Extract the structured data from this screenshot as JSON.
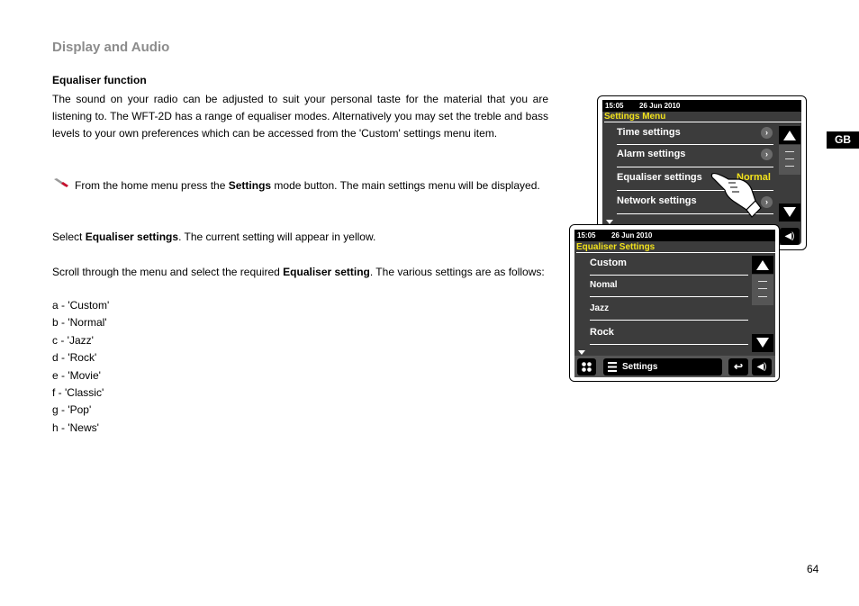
{
  "page": {
    "section_title": "Display and Audio",
    "subheading": "Equaliser function",
    "intro": "The sound on your radio can be adjusted to suit your personal taste for the material that you are listening to. The WFT-2D has a range of equaliser modes. Alternatively you may set the treble and bass levels to your own preferences which can be accessed from the 'Custom' settings menu item.",
    "step1": {
      "pre": "From the home menu press the ",
      "bold": "Settings",
      "post": " mode button. The main settings menu will be displayed."
    },
    "step2": {
      "pre": "Select ",
      "bold": "Equaliser settings",
      "post": ". The current setting will appear in yellow."
    },
    "step3": {
      "pre": "Scroll through the menu and select the required ",
      "bold": "Equaliser setting",
      "post": ". The various settings are as follows:"
    },
    "options": [
      "a - 'Custom'",
      "b - 'Normal'",
      "c - 'Jazz'",
      "d - 'Rock'",
      "e - 'Movie'",
      "f - 'Classic'",
      "g - 'Pop'",
      "h - 'News'"
    ],
    "language_tab": "GB",
    "page_number": "64"
  },
  "screen1": {
    "time": "15:05",
    "date": "26 Jun 2010",
    "title": "Settings Menu",
    "items": [
      {
        "label": "Time settings"
      },
      {
        "label": "Alarm settings"
      },
      {
        "label": "Equaliser settings",
        "value": "Normal"
      },
      {
        "label": "Network settings"
      }
    ],
    "accent": "#f2e21c"
  },
  "screen2": {
    "time": "15:05",
    "date": "26 Jun 2010",
    "title": "Equaliser Settings",
    "items": [
      "Custom",
      "Nomal",
      "Jazz",
      "Rock"
    ],
    "footer_label": "Settings"
  }
}
